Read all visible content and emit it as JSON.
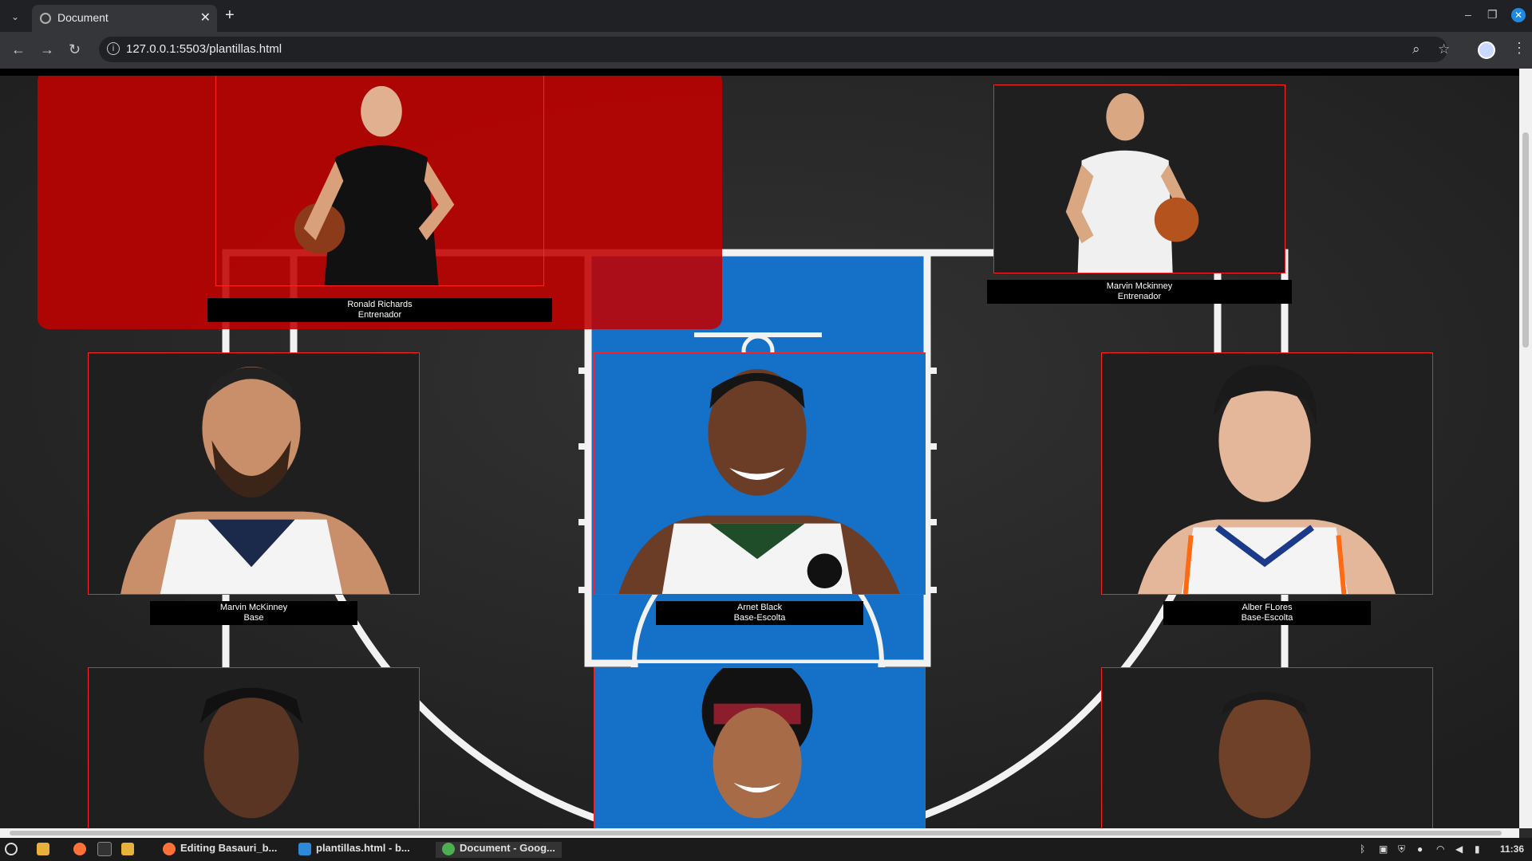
{
  "browser": {
    "tab_title": "Document",
    "url": "127.0.0.1:5503/plantillas.html"
  },
  "coaches": [
    {
      "name": "Ronald Richards",
      "role": "Entrenador"
    },
    {
      "name": "Marvin Mckinney",
      "role": "Entrenador"
    }
  ],
  "players": [
    {
      "name": "Marvin McKinney",
      "role": "Base"
    },
    {
      "name": "Arnet Black",
      "role": "Base-Escolta"
    },
    {
      "name": "Alber FLores",
      "role": "Base-Escolta"
    }
  ],
  "taskbar": {
    "items": [
      {
        "label": "Editing Basauri_b..."
      },
      {
        "label": "plantillas.html - b..."
      },
      {
        "label": "Document - Goog..."
      }
    ],
    "clock": "11:36"
  },
  "colors": {
    "highlight": "#c00000",
    "court_paint": "#1570c7",
    "card_border": "#ff2222"
  }
}
